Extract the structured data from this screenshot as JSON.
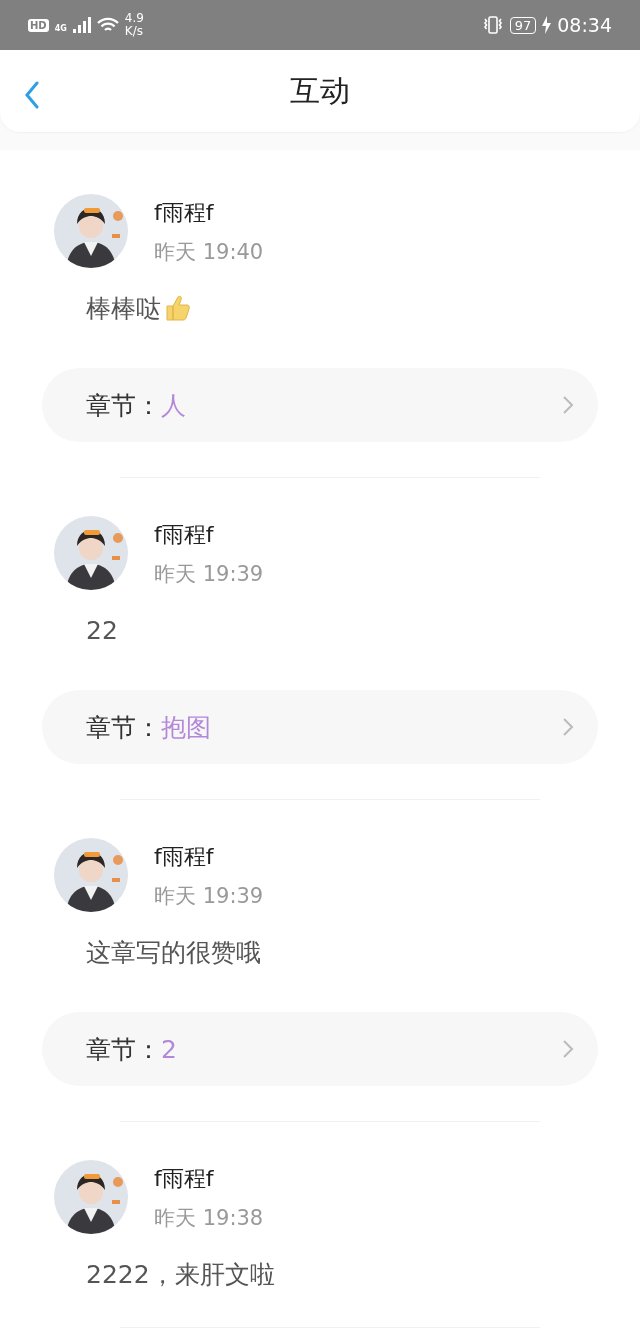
{
  "status_bar": {
    "hd": "HD",
    "network": "4G",
    "speed_value": "4.9",
    "speed_unit": "K/s",
    "battery": "97",
    "charging": true,
    "time": "08:34"
  },
  "header": {
    "title": "互动"
  },
  "items": [
    {
      "name": "f雨程f",
      "time": "昨天 19:40",
      "comment": "棒棒哒",
      "thumbs_up": true,
      "chapter": {
        "label": "章节：",
        "value": "人"
      }
    },
    {
      "name": "f雨程f",
      "time": "昨天 19:39",
      "comment": "22",
      "chapter": {
        "label": "章节：",
        "value": "抱图"
      }
    },
    {
      "name": "f雨程f",
      "time": "昨天 19:39",
      "comment": "这章写的很赞哦",
      "chapter": {
        "label": "章节：",
        "value": "2"
      }
    },
    {
      "name": "f雨程f",
      "time": "昨天 19:38",
      "comment": "2222，来肝文啦"
    }
  ]
}
